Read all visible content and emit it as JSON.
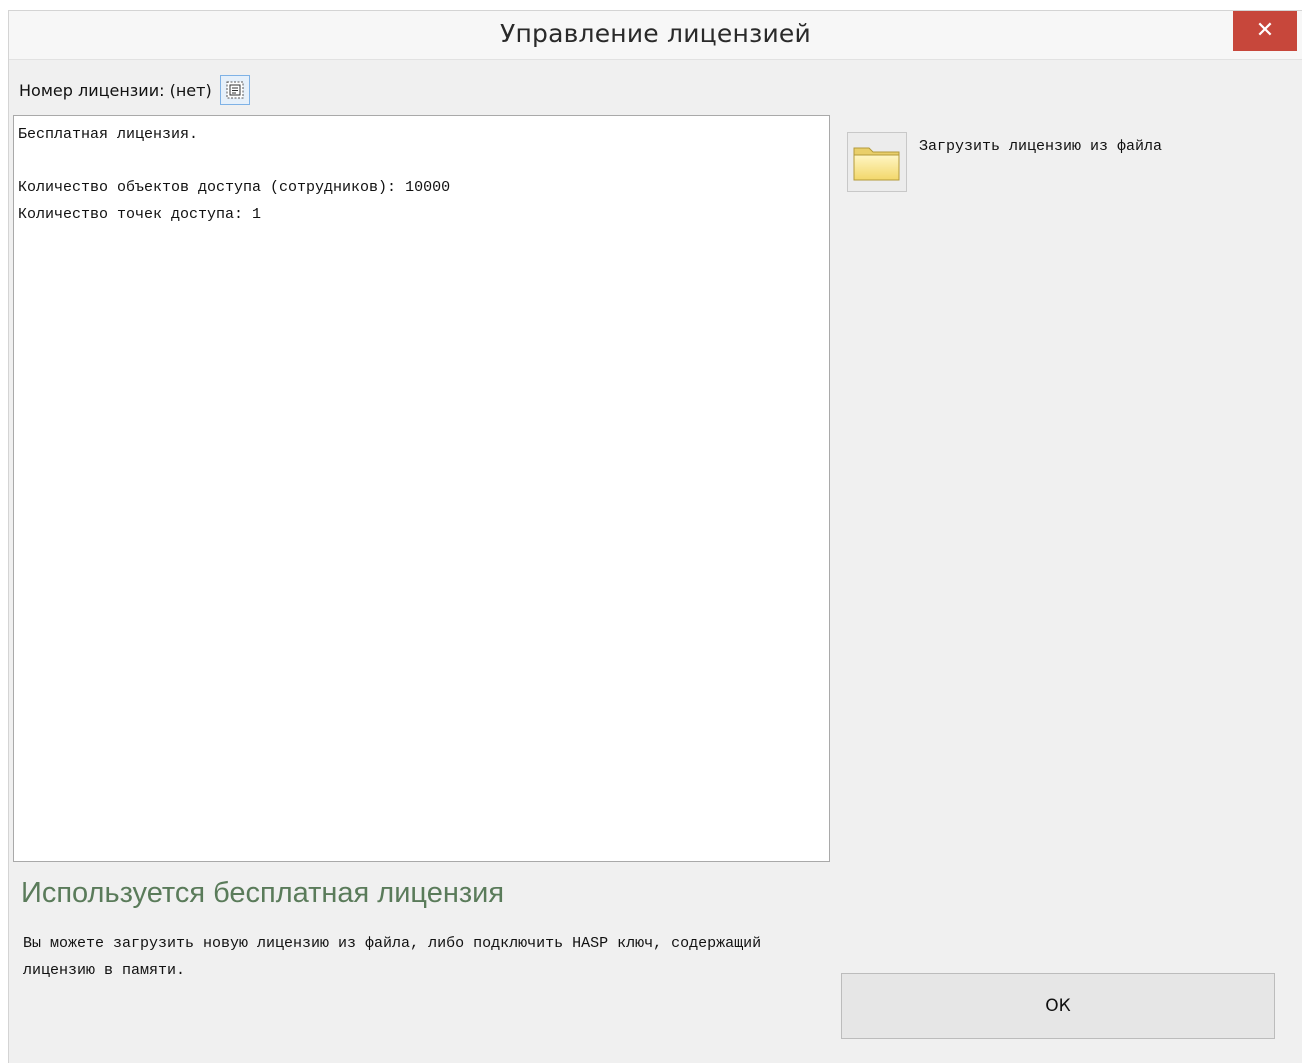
{
  "window": {
    "title": "Управление лицензией",
    "close_glyph": "✕"
  },
  "license": {
    "number_label": "Номер лицензии: (нет)",
    "copy_icon": "copy-text-icon"
  },
  "info": {
    "text": "Бесплатная лицензия.\n\nКоличество объектов доступа (сотрудников): 10000\nКоличество точек доступа: 1"
  },
  "actions": {
    "load_icon": "folder-icon",
    "load_label": "Загрузить лицензию из файла",
    "ok_label": "ОК"
  },
  "status": {
    "heading": "Используется бесплатная лицензия",
    "description": "Вы можете загрузить новую лицензию из файла, либо подключить HASP ключ, содержащий лицензию в памяти."
  },
  "colors": {
    "close_button": "#c7473b",
    "status_heading": "#5a7b5a",
    "copy_button_border": "#7fb2e6"
  }
}
